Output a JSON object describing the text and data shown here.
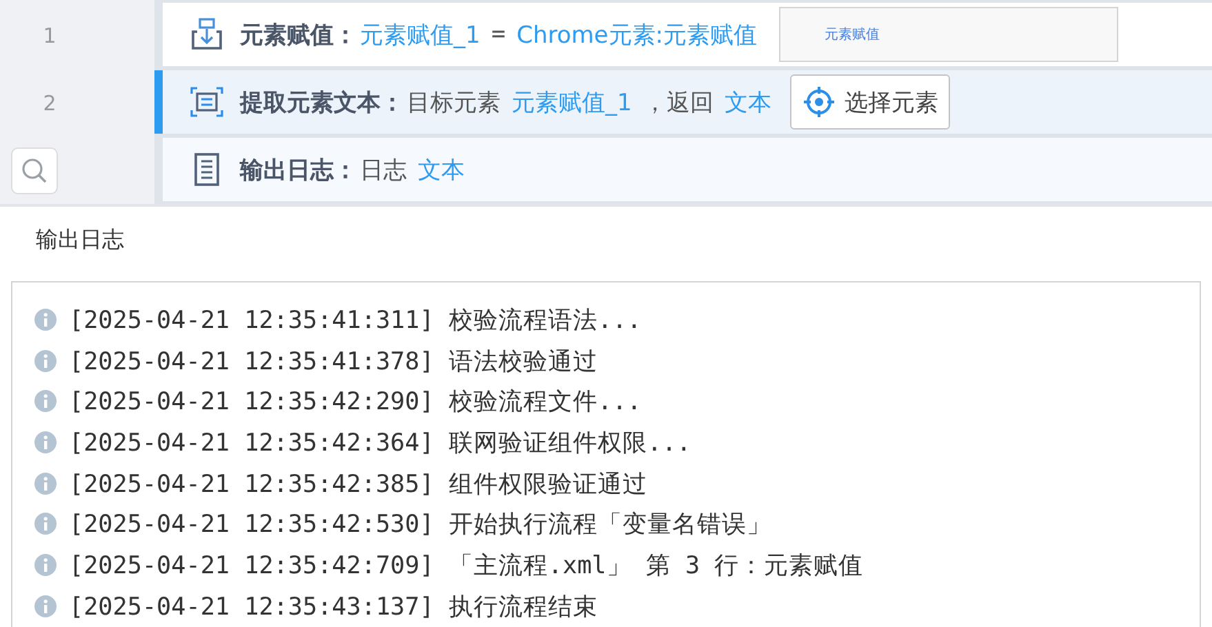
{
  "steps": [
    {
      "number": "1",
      "title": "元素赋值：",
      "selected": false,
      "parts": [
        {
          "kind": "var",
          "text": "元素赋值_1"
        },
        {
          "kind": "code",
          "text": "="
        },
        {
          "kind": "var",
          "text": "Chrome元素:元素赋值"
        }
      ],
      "preview": "元素赋值"
    },
    {
      "number": "2",
      "title": "提取元素文本：",
      "selected": true,
      "parts": [
        {
          "kind": "plain",
          "text": "目标元素"
        },
        {
          "kind": "var",
          "text": "元素赋值_1"
        },
        {
          "kind": "plain",
          "text": "，返回"
        },
        {
          "kind": "var",
          "text": "文本"
        }
      ],
      "button": "选择元素"
    },
    {
      "title": "输出日志：",
      "selected": false,
      "parts": [
        {
          "kind": "plain",
          "text": "日志"
        },
        {
          "kind": "var",
          "text": "文本"
        }
      ]
    }
  ],
  "log_panel": {
    "title": "输出日志",
    "lines": [
      "[2025-04-21 12:35:41:311] 校验流程语法...",
      "[2025-04-21 12:35:41:378] 语法校验通过",
      "[2025-04-21 12:35:42:290] 校验流程文件...",
      "[2025-04-21 12:35:42:364] 联网验证组件权限...",
      "[2025-04-21 12:35:42:385] 组件权限验证通过",
      "[2025-04-21 12:35:42:530] 开始执行流程「变量名错误」",
      "[2025-04-21 12:35:42:709] 「主流程.xml」 第 3 行：元素赋值",
      "[2025-04-21 12:35:43:137] 执行流程结束"
    ]
  }
}
